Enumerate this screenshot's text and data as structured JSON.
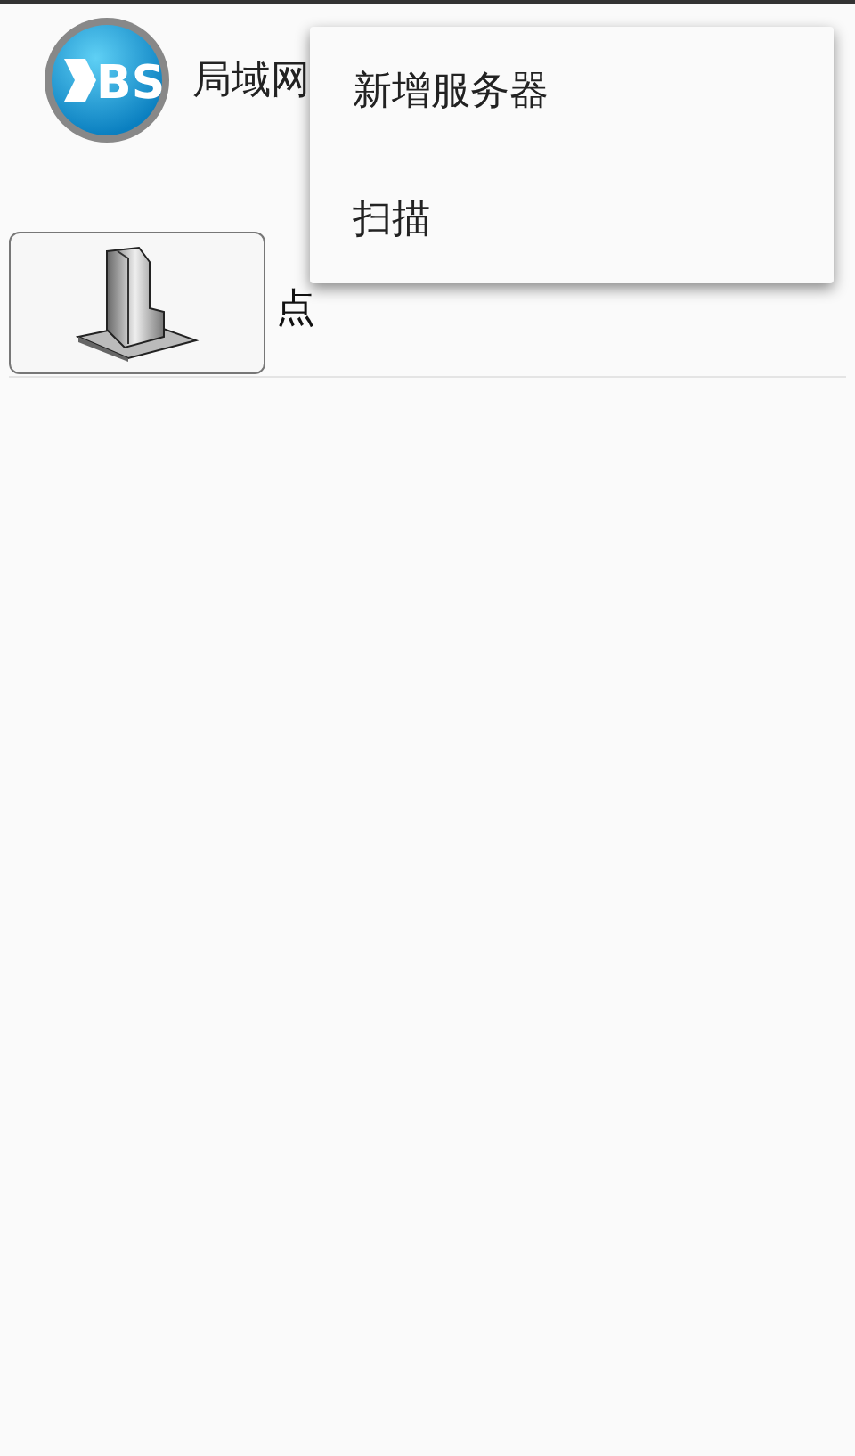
{
  "app_bar": {
    "logo_text": "BS",
    "title": "局域网"
  },
  "servers": [
    {
      "label": "点"
    }
  ],
  "menu": {
    "items": [
      {
        "label": "新增服务器"
      },
      {
        "label": "扫描"
      }
    ]
  }
}
